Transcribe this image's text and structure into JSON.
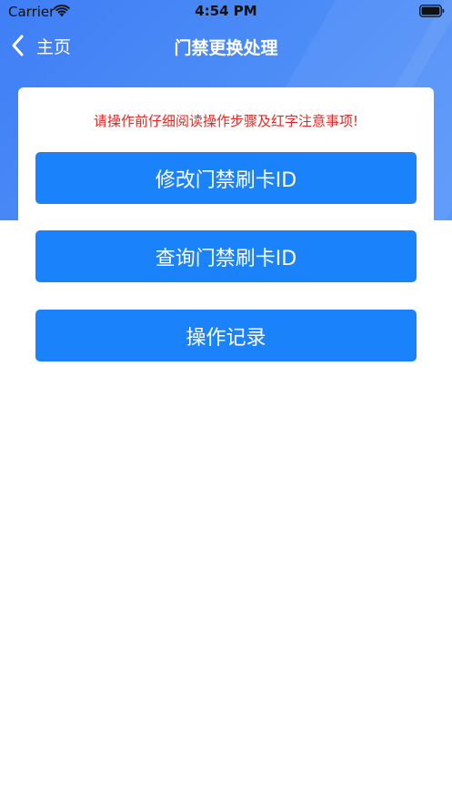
{
  "status_bar": {
    "carrier": "Carrier",
    "time": "4:54 PM",
    "wifi_icon": "wifi-icon",
    "battery_icon": "battery-icon"
  },
  "nav": {
    "back_label": "主页",
    "back_icon": "chevron-left-icon",
    "title": "门禁更换处理"
  },
  "card": {
    "notice": "请操作前仔细阅读操作步骤及红字注意事项!",
    "buttons": [
      {
        "label": "修改门禁刷卡ID"
      },
      {
        "label": "查询门禁刷卡ID"
      },
      {
        "label": "操作记录"
      }
    ]
  },
  "colors": {
    "header_gradient_start": "#3f7ef5",
    "header_gradient_end": "#5a97fa",
    "button": "#1a82fb",
    "notice_text": "#e8251f",
    "background": "#ffffff"
  }
}
